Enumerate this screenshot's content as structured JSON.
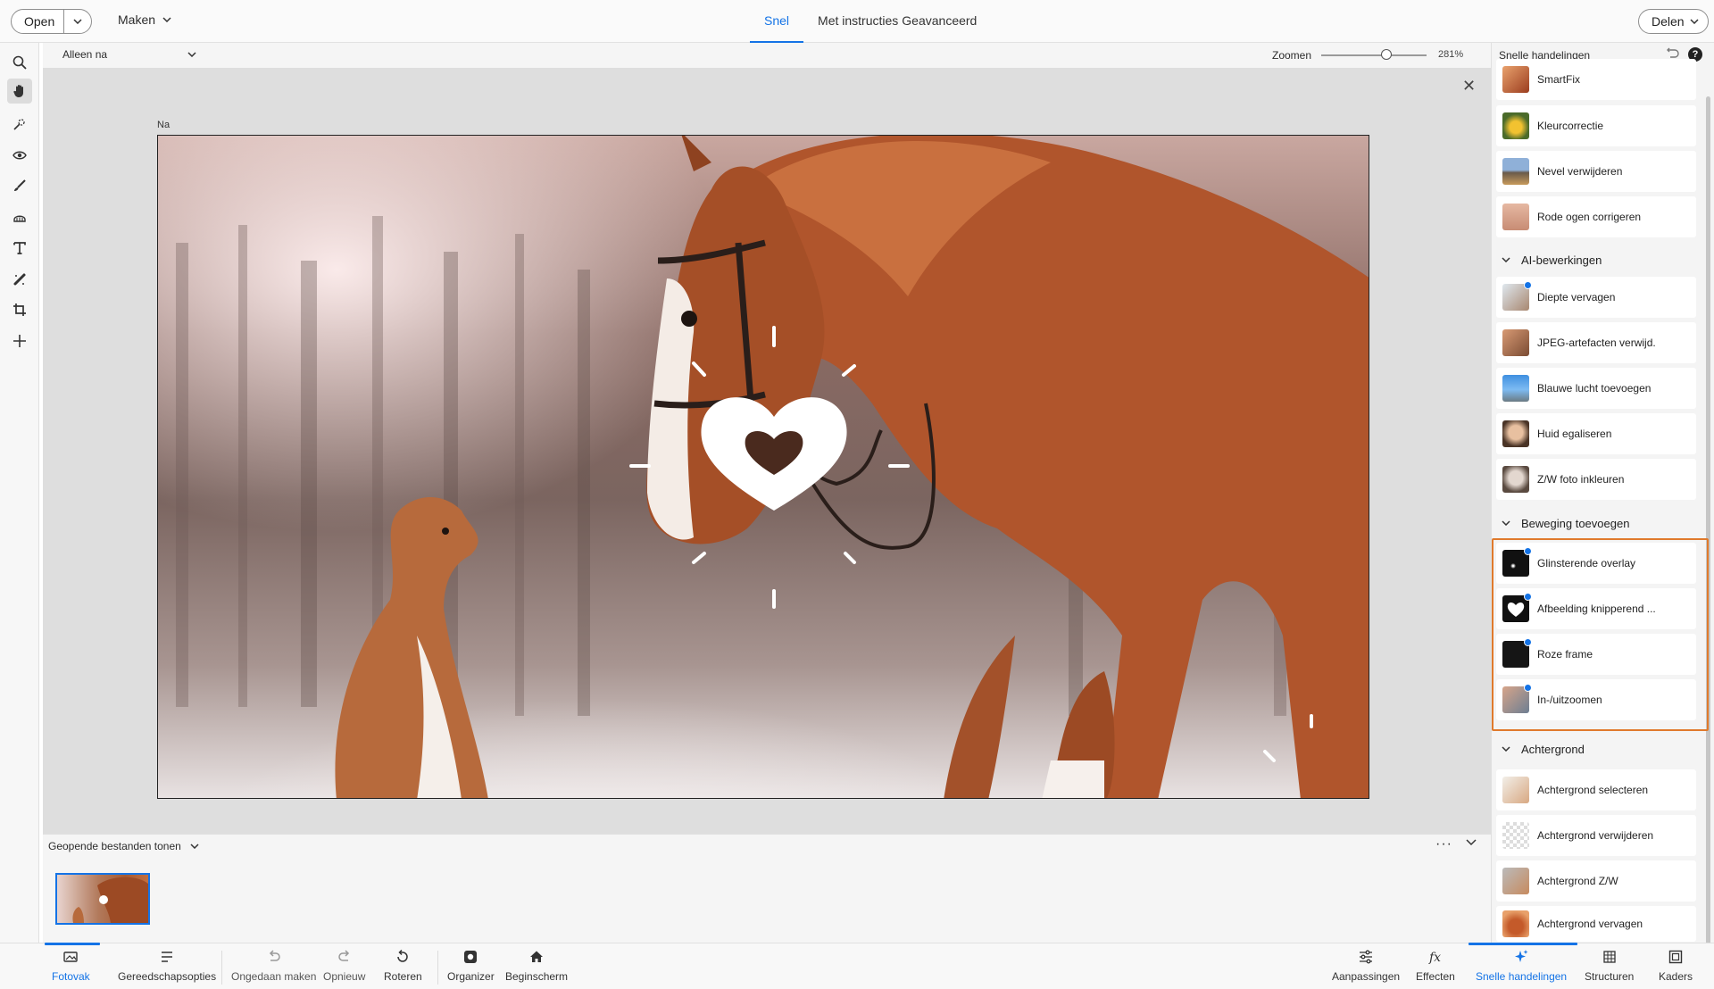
{
  "header": {
    "open_label": "Open",
    "create_label": "Maken",
    "modes": [
      {
        "label": "Snel",
        "active": true
      },
      {
        "label": "Met instructies",
        "active": false
      },
      {
        "label": "Geavanceerd",
        "active": false
      }
    ],
    "share_label": "Delen"
  },
  "options_bar": {
    "view_select": "Alleen na",
    "zoom_label": "Zoomen",
    "zoom_value": "281%",
    "zoom_level": 281
  },
  "canvas": {
    "view_label": "Na"
  },
  "filmstrip": {
    "toggle_label": "Geopende bestanden tonen",
    "more_label": "···"
  },
  "right_panel": {
    "title": "Snelle handelingen",
    "help": "?",
    "items_top": [
      {
        "label": "SmartFix",
        "icon": "smartfix-thumbnail"
      },
      {
        "label": "Kleurcorrectie",
        "icon": "color-correction-thumbnail"
      },
      {
        "label": "Nevel verwijderen",
        "icon": "haze-removal-thumbnail"
      },
      {
        "label": "Rode ogen corrigeren",
        "icon": "red-eye-thumbnail"
      }
    ],
    "sections": [
      {
        "title": "AI-bewerkingen",
        "items": [
          {
            "label": "Diepte vervagen",
            "icon": "depth-blur-thumbnail",
            "new": true
          },
          {
            "label": "JPEG-artefacten verwijd.",
            "icon": "jpeg-artifacts-thumbnail",
            "new": false
          },
          {
            "label": "Blauwe lucht toevoegen",
            "icon": "blue-sky-thumbnail",
            "new": false
          },
          {
            "label": "Huid egaliseren",
            "icon": "smooth-skin-thumbnail",
            "new": false
          },
          {
            "label": "Z/W foto inkleuren",
            "icon": "colorize-photo-thumbnail",
            "new": false
          }
        ]
      },
      {
        "title": "Beweging toevoegen",
        "items": [
          {
            "label": "Glinsterende overlay",
            "icon": "sparkle-overlay-thumbnail",
            "new": true
          },
          {
            "label": "Afbeelding knipperend ...",
            "icon": "blinking-heart-thumbnail",
            "new": true
          },
          {
            "label": "Roze frame",
            "icon": "pink-frame-thumbnail",
            "new": true
          },
          {
            "label": "In-/uitzoomen",
            "icon": "zoom-in-out-thumbnail",
            "new": true
          }
        ]
      },
      {
        "title": "Achtergrond",
        "items": [
          {
            "label": "Achtergrond selecteren",
            "icon": "select-background-thumbnail",
            "new": false
          },
          {
            "label": "Achtergrond verwijderen",
            "icon": "remove-background-thumbnail",
            "new": false
          },
          {
            "label": "Achtergrond Z/W",
            "icon": "bw-background-thumbnail",
            "new": false
          },
          {
            "label": "Achtergrond vervagen",
            "icon": "blur-background-thumbnail",
            "new": false
          }
        ]
      }
    ]
  },
  "bottom_bar": {
    "left": [
      {
        "label": "Fotovak",
        "icon": "photo-bin-icon",
        "active": true
      },
      {
        "label": "Gereedschapsopties",
        "icon": "tool-options-icon",
        "active": false
      },
      {
        "label": "Ongedaan maken",
        "icon": "undo-icon",
        "active": false
      },
      {
        "label": "Opnieuw",
        "icon": "redo-icon",
        "active": false
      },
      {
        "label": "Roteren",
        "icon": "rotate-icon",
        "active": false
      },
      {
        "label": "Organizer",
        "icon": "organizer-icon",
        "active": false
      },
      {
        "label": "Beginscherm",
        "icon": "home-icon",
        "active": false
      }
    ],
    "right": [
      {
        "label": "Aanpassingen",
        "icon": "adjustments-icon",
        "active": false
      },
      {
        "label": "Effecten",
        "icon": "effects-icon",
        "active": false
      },
      {
        "label": "Snelle handelingen",
        "icon": "quick-actions-icon",
        "active": true
      },
      {
        "label": "Structuren",
        "icon": "textures-icon",
        "active": false
      },
      {
        "label": "Kaders",
        "icon": "frames-icon",
        "active": false
      }
    ]
  },
  "colors": {
    "accent": "#1473e6",
    "highlight": "#e07a2c"
  }
}
